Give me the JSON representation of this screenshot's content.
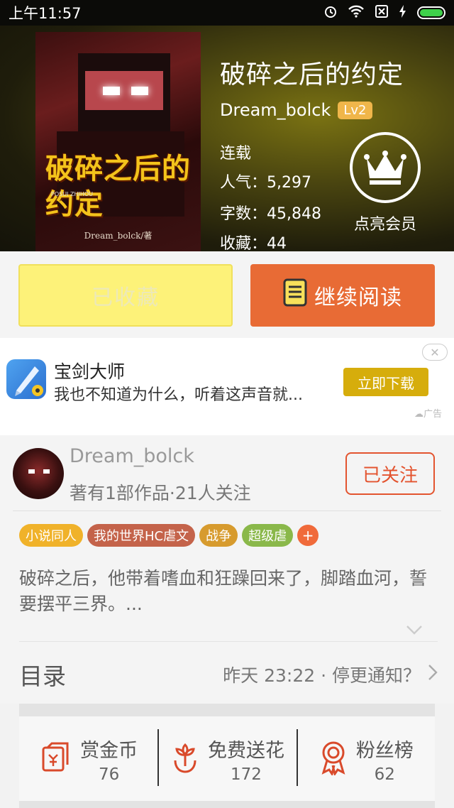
{
  "status_bar": {
    "time": "上午11:57"
  },
  "book": {
    "title": "破碎之后的约定",
    "author": "Dream_bolck",
    "level": "Lv2",
    "status": "连载",
    "popularity_label": "人气：",
    "popularity": "5,297",
    "words_label": "字数：",
    "words": "45,848",
    "favorites_label": "收藏：",
    "favorites": "44",
    "cover_title": "破碎之后的约定",
    "cover_pinyin": "POSUI ZHIHOU",
    "cover_byline": "Dream_bolck/著",
    "vip_label": "点亮会员"
  },
  "actions": {
    "favorited_label": "已收藏",
    "continue_label": "继续阅读"
  },
  "ad": {
    "title": "宝剑大师",
    "description": "我也不知道为什么，听着这声音就...",
    "button_label": "立即下载",
    "tag": "广告"
  },
  "author_card": {
    "name": "Dream_bolck",
    "meta": "著有1部作品·21人关注",
    "follow_label": "已关注"
  },
  "tags": [
    "小说同人",
    "我的世界HC虐文",
    "战争",
    "超级虐"
  ],
  "synopsis": "破碎之后，他带着嗜血和狂躁回来了，脚踏血河，誓要摆平三界。...",
  "catalog": {
    "label": "目录",
    "info": "昨天 23:22 · 停更通知？"
  },
  "stats": [
    {
      "label": "赏金币",
      "value": "76",
      "icon": "reward-coin-icon"
    },
    {
      "label": "免费送花",
      "value": "172",
      "icon": "flower-icon"
    },
    {
      "label": "粉丝榜",
      "value": "62",
      "icon": "medal-icon"
    }
  ],
  "colors": {
    "accent_orange": "#e86b35",
    "favorite_yellow": "#fdf279",
    "follow_red": "#e3542f",
    "icon_red": "#d94a2b"
  }
}
